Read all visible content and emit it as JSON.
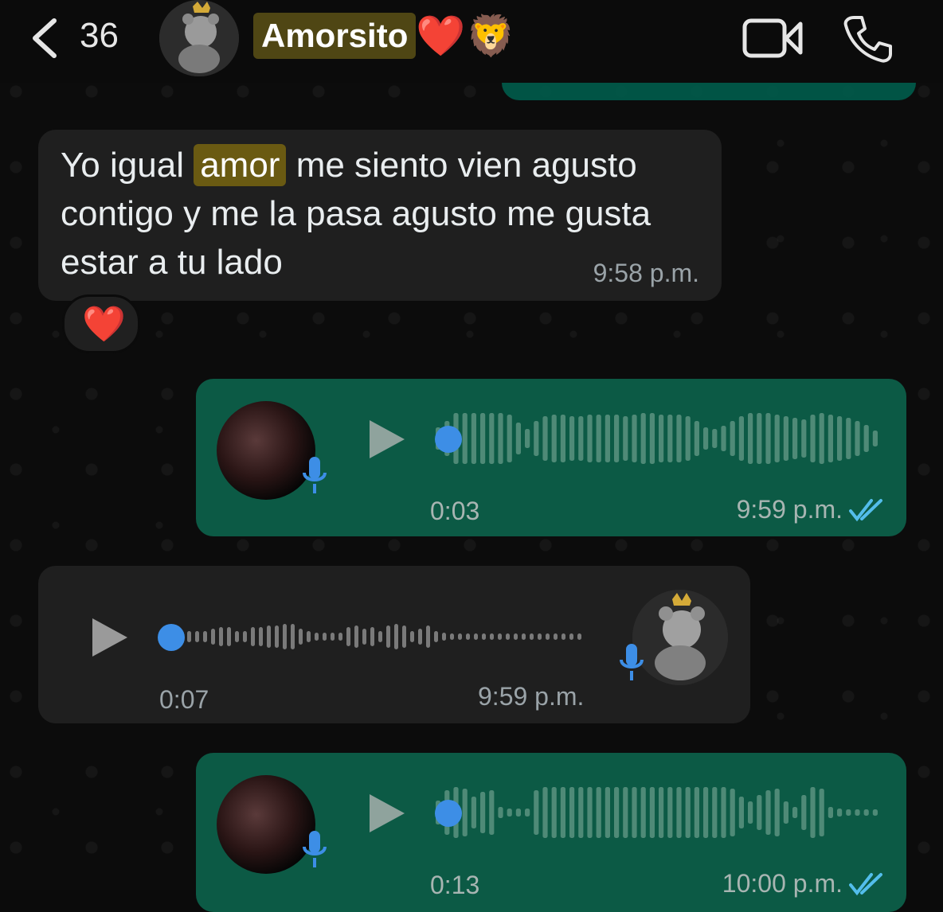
{
  "header": {
    "back_count": "36",
    "contact_name": "Amorsito",
    "name_emoji_1": "❤️",
    "name_emoji_2": "🦁"
  },
  "messages": [
    {
      "type": "text",
      "direction": "incoming",
      "text_before": "Yo igual",
      "highlight": "amor",
      "text_after": "me siento vien agusto contigo y me la pasa agusto me gusta estar a tu lado",
      "time": "9:58 p.m.",
      "reaction": "❤️"
    },
    {
      "type": "voice",
      "direction": "outgoing",
      "duration": "0:03",
      "time": "9:59 p.m."
    },
    {
      "type": "voice",
      "direction": "incoming",
      "duration": "0:07",
      "time": "9:59 p.m."
    },
    {
      "type": "voice",
      "direction": "outgoing",
      "duration": "0:13",
      "time": "10:00 p.m."
    }
  ],
  "colors": {
    "outgoing_bubble": "#0c5a45",
    "incoming_bubble": "#1f1f1f",
    "accent_blue": "#3d8ee6",
    "highlight": "#6a5a12"
  },
  "icons": [
    "back-chevron-icon",
    "video-call-icon",
    "phone-call-icon",
    "play-icon",
    "microphone-icon",
    "double-check-icon"
  ]
}
